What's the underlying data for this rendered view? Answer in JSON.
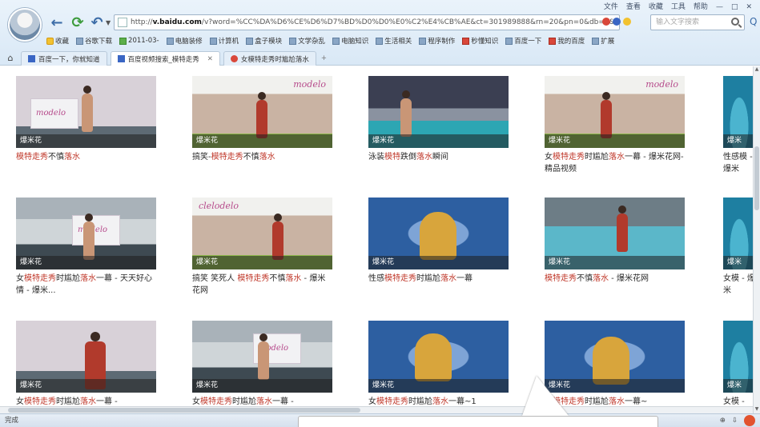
{
  "browser": {
    "menu": [
      "文件",
      "查看",
      "收藏",
      "工具",
      "帮助"
    ],
    "url_prefix": "http://",
    "url_host": "v.baidu.com",
    "url_rest": "/v?word=%CC%DA%D6%CE%D6%D7%BD%D0%D0%E0%C2%E4%CB%AE&ct=301989888&rn=20&pn=0&db=0&s=0&fbl=800",
    "search_placeholder": "输入文字搜索",
    "favorites": [
      "收藏",
      "谷歌下载",
      "2011-03-",
      "电脑装修",
      "计算机",
      "盒子模块",
      "文学杂乱",
      "电脑知识",
      "生活相关",
      "程序制作",
      "秒懂知识",
      "百度一下",
      "我的百度",
      "扩展"
    ],
    "tabs": [
      {
        "label": "百度一下，你就知道"
      },
      {
        "label": "百度视频搜索_模特走秀"
      },
      {
        "label": "女模特走秀时尴尬落水"
      }
    ]
  },
  "results": [
    {
      "caption": "爆米花",
      "title_parts": [
        {
          "t": "模特走秀",
          "hl": true
        },
        {
          "t": "不慎",
          "hl": false
        },
        {
          "t": "落水",
          "hl": true
        }
      ]
    },
    {
      "caption": "爆米花",
      "title_parts": [
        {
          "t": "搞笑-",
          "hl": false
        },
        {
          "t": "模特走秀",
          "hl": true
        },
        {
          "t": "不慎",
          "hl": false
        },
        {
          "t": "落水",
          "hl": true
        }
      ]
    },
    {
      "caption": "爆米花",
      "title_parts": [
        {
          "t": "泳装",
          "hl": false
        },
        {
          "t": "模特",
          "hl": true
        },
        {
          "t": "跌倒",
          "hl": false
        },
        {
          "t": "落水",
          "hl": true
        },
        {
          "t": "瞬间",
          "hl": false
        }
      ]
    },
    {
      "caption": "爆米花",
      "title_parts": [
        {
          "t": "女",
          "hl": false
        },
        {
          "t": "模特走秀",
          "hl": true
        },
        {
          "t": "时尴尬",
          "hl": false
        },
        {
          "t": "落水",
          "hl": true
        },
        {
          "t": "一幕 - 爆米花网-精品视频",
          "hl": false
        }
      ]
    },
    {
      "caption": "爆米花",
      "title_parts": [
        {
          "t": "女",
          "hl": false
        },
        {
          "t": "模特走秀",
          "hl": true
        },
        {
          "t": "时尴尬",
          "hl": false
        },
        {
          "t": "落水",
          "hl": true
        },
        {
          "t": "一幕 - 天天好心情 - 爆米...",
          "hl": false
        }
      ]
    },
    {
      "caption": "爆米花",
      "title_parts": [
        {
          "t": "搞笑 笑死人 ",
          "hl": false
        },
        {
          "t": "模特走秀",
          "hl": true
        },
        {
          "t": "不慎",
          "hl": false
        },
        {
          "t": "落水",
          "hl": true
        },
        {
          "t": " - 爆米花网",
          "hl": false
        }
      ]
    },
    {
      "caption": "爆米花",
      "title_parts": [
        {
          "t": "性感",
          "hl": false
        },
        {
          "t": "模特走秀",
          "hl": true
        },
        {
          "t": "时尴尬",
          "hl": false
        },
        {
          "t": "落水",
          "hl": true
        },
        {
          "t": "一幕",
          "hl": false
        }
      ]
    },
    {
      "caption": "爆米花",
      "title_parts": [
        {
          "t": "模特走秀",
          "hl": true
        },
        {
          "t": "不慎",
          "hl": false
        },
        {
          "t": "落水",
          "hl": true
        },
        {
          "t": " - 爆米花网",
          "hl": false
        }
      ]
    },
    {
      "caption": "爆米花",
      "title_parts": [
        {
          "t": "女",
          "hl": false
        },
        {
          "t": "模特走秀",
          "hl": true
        },
        {
          "t": "时尴尬",
          "hl": false
        },
        {
          "t": "落水",
          "hl": true
        },
        {
          "t": "一幕 -",
          "hl": false
        }
      ]
    },
    {
      "caption": "爆米花",
      "title_parts": [
        {
          "t": "女",
          "hl": false
        },
        {
          "t": "模特走秀",
          "hl": true
        },
        {
          "t": "时尴尬",
          "hl": false
        },
        {
          "t": "落水",
          "hl": true
        },
        {
          "t": "一幕 -",
          "hl": false
        }
      ]
    },
    {
      "caption": "爆米花",
      "title_parts": [
        {
          "t": "女",
          "hl": false
        },
        {
          "t": "模特走秀",
          "hl": true
        },
        {
          "t": "时尴尬",
          "hl": false
        },
        {
          "t": "落水",
          "hl": true
        },
        {
          "t": "一幕~1",
          "hl": false
        }
      ]
    },
    {
      "caption": "爆米花",
      "title_parts": [
        {
          "t": "女",
          "hl": false
        },
        {
          "t": "模特走秀",
          "hl": true
        },
        {
          "t": "时尴尬",
          "hl": false
        },
        {
          "t": "落水",
          "hl": true
        },
        {
          "t": "一幕~",
          "hl": false
        }
      ]
    }
  ],
  "partial_column": [
    {
      "caption": "爆米",
      "title": "性感模 - 爆米"
    },
    {
      "caption": "爆米",
      "title": "女模 - 爆米"
    },
    {
      "caption": "爆米",
      "title": "女模 -"
    }
  ],
  "status": {
    "left": "完成"
  },
  "colors": {
    "highlight": "#c0392b",
    "chrome": "#d9e8f6"
  }
}
